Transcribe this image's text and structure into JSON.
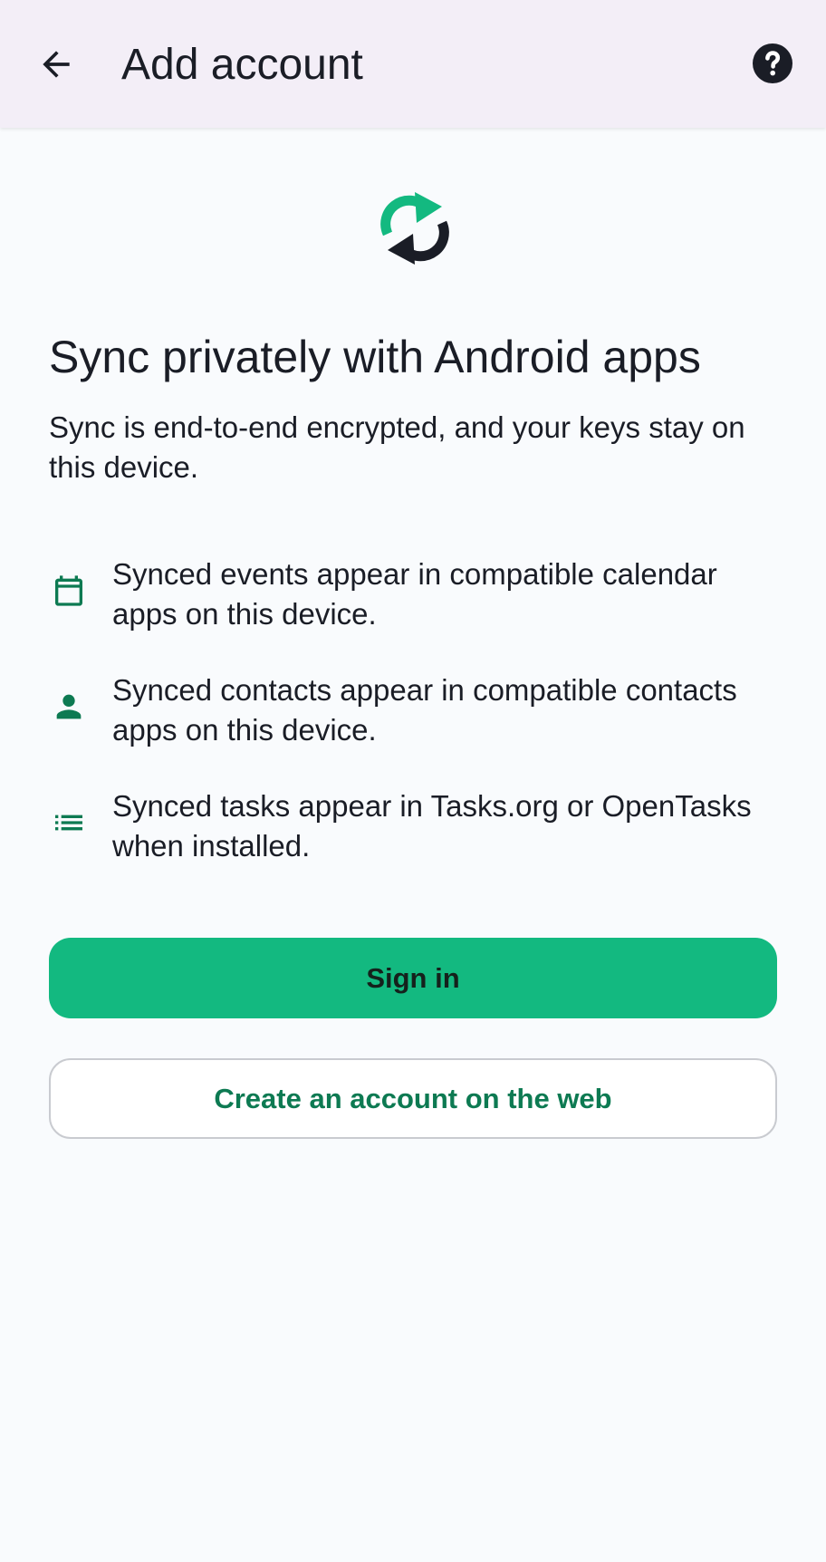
{
  "app_bar": {
    "title": "Add account",
    "back_icon": "arrow-back-icon",
    "help_icon": "help-circle-icon"
  },
  "hero": {
    "icon": "sync-icon"
  },
  "main": {
    "heading": "Sync privately with Android apps",
    "subtitle": "Sync is end-to-end encrypted, and your keys stay on this device.",
    "features": [
      {
        "icon": "calendar-icon",
        "text": "Synced events appear in compatible calendar apps on this device."
      },
      {
        "icon": "person-icon",
        "text": "Synced contacts appear in compatible contacts apps on this device."
      },
      {
        "icon": "list-icon",
        "text": "Synced tasks appear in Tasks.org or OpenTasks when installed."
      }
    ]
  },
  "actions": {
    "sign_in_label": "Sign in",
    "create_account_label": "Create an account on the web"
  },
  "colors": {
    "accent": "#13b980",
    "accent_dark": "#0d7a52",
    "app_bar_bg": "#f3eef7",
    "page_bg": "#f9fbfd",
    "text": "#1a1d26"
  }
}
